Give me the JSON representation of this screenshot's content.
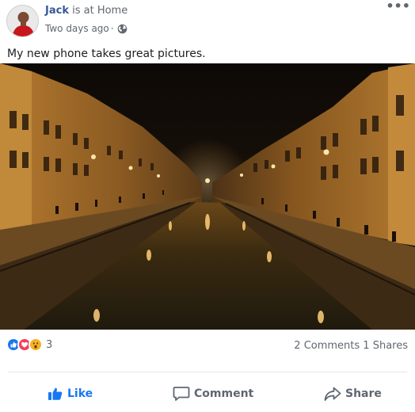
{
  "post": {
    "author": "Jack",
    "activity": "is at Home",
    "timestamp": "Two days ago",
    "separator": "·",
    "privacy_icon": "globe-icon",
    "more_icon": "more-options-icon",
    "more_glyph": "•••",
    "text": "My new phone takes great pictures.",
    "image_icon": "photo-canal-night"
  },
  "stats": {
    "reactions": [
      "like-icon",
      "love-icon",
      "wow-icon"
    ],
    "reaction_count": "3",
    "comments_shares": "2 Comments 1 Shares"
  },
  "actions": {
    "like_label": "Like",
    "comment_label": "Comment",
    "share_label": "Share"
  },
  "colors": {
    "author": "#385898",
    "like_active": "#1877f2",
    "muted": "#606770",
    "love": "#f33e58",
    "wow": "#f7b125"
  }
}
